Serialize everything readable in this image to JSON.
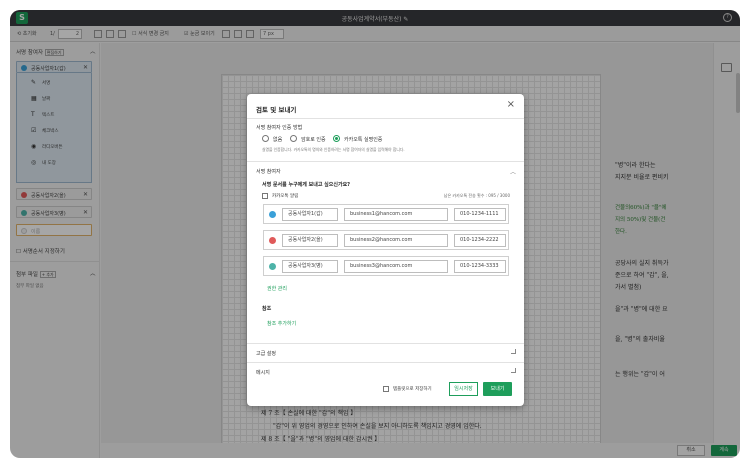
{
  "app": {
    "logo_letter": "S",
    "title": "공동사업계약서(부동산)",
    "help": "?"
  },
  "toolbar": {
    "reset": "초기화",
    "page_current": "2",
    "page_of": "1/",
    "fill_sequential": "서식 변경 금지",
    "grid_toggle": "눈금 보이기",
    "grid_size": "7",
    "grid_unit": "px"
  },
  "sidebar": {
    "participants_title": "서명 참여자",
    "participants_tag": "편집하기",
    "participants": [
      {
        "name": "공동사업자1(갑)",
        "color": "#3aa0d8"
      },
      {
        "name": "공동사업자2(을)",
        "color": "#e05a5a"
      },
      {
        "name": "공동사업자3(병)",
        "color": "#4db3a8"
      }
    ],
    "tools": [
      {
        "icon": "✎",
        "label": "서명"
      },
      {
        "icon": "▦",
        "label": "날짜"
      },
      {
        "icon": "T",
        "label": "텍스트"
      },
      {
        "icon": "☑",
        "label": "체크박스"
      },
      {
        "icon": "◉",
        "label": "라디오버튼"
      },
      {
        "icon": "◎",
        "label": "내 도장"
      }
    ],
    "add_participant_placeholder": "이름",
    "order_label": "서명순서 지정하기",
    "attach_title": "첨부 파일",
    "attach_tag": "+ 추가",
    "attach_empty": "첨부 파일 없음"
  },
  "document": {
    "lines": [
      "\"병\"이라 한다는",
      "지지분 비율로 편비키",
      "건물의60%)과 \"을\"에",
      "지의 50%)및 건물(건",
      "한다.",
      "공당사의 실지 취득가",
      "준으로 하여 \"갑\", 을,",
      "가서 별첨)",
      "을\"과 \"병\"에 대한 요",
      "을, \"병\"의 출자비율",
      "는 행위는 \"갑\"이 어",
      "제 7 조【 손실에 대한 \"갑\"의 책임 】",
      "\"갑\"이 위 영업의 경영으로 인하여 손실을 보지 아니하도록 책임지고 경영에 임한다.",
      "제 8 조【 \"을\"과 \"병\"의 영업에 대한 감시권 】"
    ]
  },
  "bottom": {
    "cancel": "취소",
    "next": "계속"
  },
  "modal": {
    "title": "검토 및 보내기",
    "close": "×",
    "auth_title": "서명 참여자 인증 방법",
    "auth_options": [
      "없음",
      "암호로 인증",
      "카카오톡 실명인증"
    ],
    "auth_selected_index": 2,
    "auth_note": "실명을 인증합니다. 카카오톡의 명의와 인증하려는 서명 참여자의 실명을 입력해야 합니다.",
    "participants_section": "서명 참여자",
    "question": "서명 문서를 누구에게 보내고 싶으신가요?",
    "kakao_alert": "카카오톡 알림",
    "remaining": "남은 카카오톡 전송 횟수 : 095 / 3000",
    "rows": [
      {
        "name": "공동사업자1(갑)",
        "email": "business1@hancom.com",
        "phone": "010-1234-1111",
        "color": "#3aa0d8"
      },
      {
        "name": "공동사업자2(을)",
        "email": "business2@hancom.com",
        "phone": "010-1234-2222",
        "color": "#e05a5a"
      },
      {
        "name": "공동사업자3(병)",
        "email": "business3@hancom.com",
        "phone": "010-1234-3333",
        "color": "#4db3a8"
      }
    ],
    "perm_link": "권한 관리",
    "cc_title": "참조",
    "cc_link": "참조 추가하기",
    "advanced": "고급 설정",
    "message": "메시지",
    "save_template": "템플릿으로 저장하기",
    "temp_save": "임시저장",
    "send": "보내기"
  },
  "colors": {
    "brand_green": "#1e9e5b",
    "titlebar": "#3a3b3f"
  }
}
